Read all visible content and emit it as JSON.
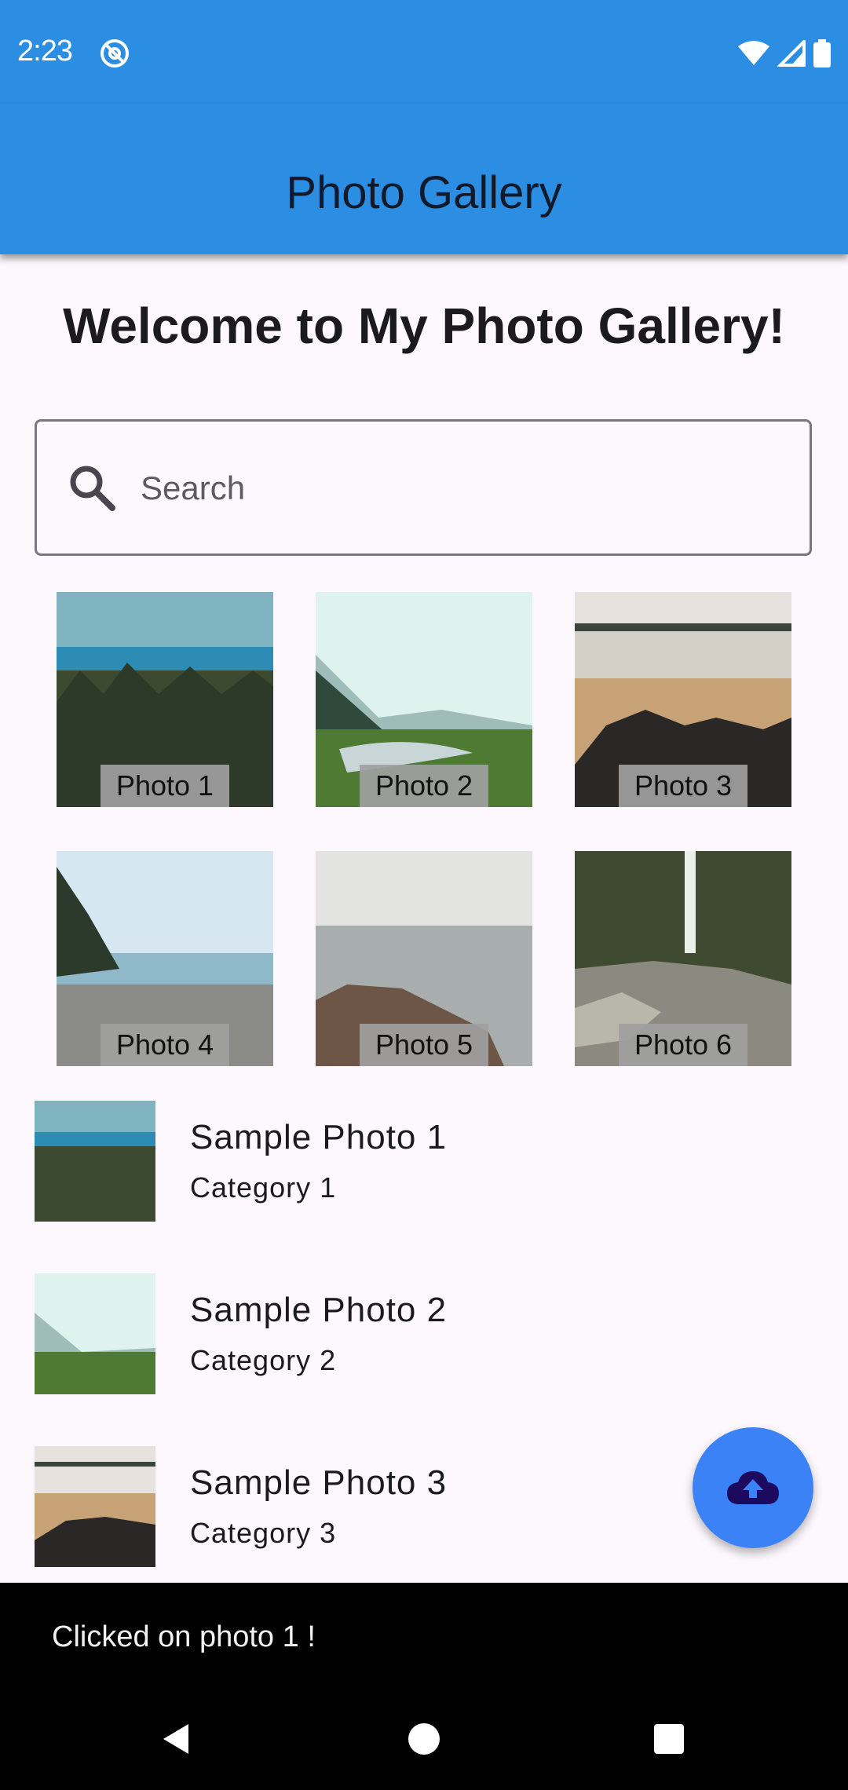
{
  "status_bar": {
    "time": "2:23",
    "app_icon": "at-sign-icon",
    "icons": [
      "wifi-icon",
      "signal-icon",
      "battery-icon"
    ]
  },
  "app_bar": {
    "title": "Photo Gallery",
    "color": "#2b8ee2"
  },
  "welcome_heading": "Welcome to My Photo Gallery!",
  "search": {
    "placeholder": "Search",
    "value": "",
    "icon": "search-icon"
  },
  "grid": [
    {
      "caption": "Photo 1"
    },
    {
      "caption": "Photo 2"
    },
    {
      "caption": "Photo 3"
    },
    {
      "caption": "Photo 4"
    },
    {
      "caption": "Photo 5"
    },
    {
      "caption": "Photo 6"
    }
  ],
  "list": [
    {
      "title": "Sample Photo 1",
      "subtitle": "Category 1"
    },
    {
      "title": "Sample Photo 2",
      "subtitle": "Category 2"
    },
    {
      "title": "Sample Photo 3",
      "subtitle": "Category 3"
    }
  ],
  "fab": {
    "icon": "cloud-upload-icon",
    "color": "#3b82f6"
  },
  "snackbar": {
    "text": "Clicked on photo 1 !"
  },
  "nav_bar": {
    "icons": [
      "back-icon",
      "home-icon",
      "recents-icon"
    ]
  }
}
